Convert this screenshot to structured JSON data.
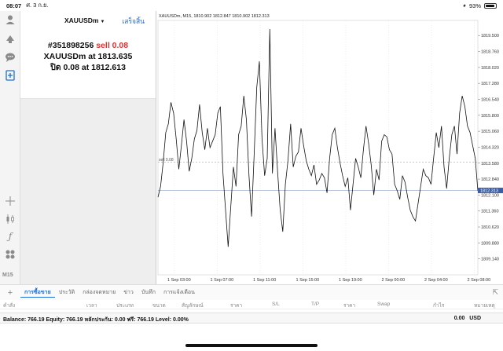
{
  "status_bar": {
    "time": "08:07",
    "date": "ศ. 3 ก.ย.",
    "battery": "93%"
  },
  "order": {
    "symbol": "XAUUSDm",
    "done_label": "เสร็จสิ้น",
    "ticket": "#351898256",
    "side": "sell 0.08",
    "line2_prefix": "XAUUSDm at",
    "open_price": "1813.635",
    "line3_prefix": "ปิด 0.08 at",
    "close_price": "1812.613"
  },
  "toolbar": {
    "timeframe": "M15"
  },
  "chart": {
    "title": "XAUUSDm, M15, 1810.902 1812.847 1810.902 1812.313",
    "current_price": "1812.313",
    "order_line_label": "sell 0.08",
    "colors": {
      "line": "#111111",
      "current_price_bg": "#3a5fa8",
      "order_line": "#909090"
    }
  },
  "chart_data": {
    "type": "line",
    "title": "XAUUSDm, M15, 1810.902 1812.847 1810.902 1812.313",
    "xlabel": "",
    "ylabel": "",
    "ylim": [
      1808.4,
      1820.2
    ],
    "y_ticks": [
      "1819.500",
      "1818.760",
      "1818.020",
      "1817.280",
      "1816.540",
      "1815.800",
      "1815.060",
      "1814.320",
      "1813.580",
      "1812.840",
      "1812.100",
      "1811.360",
      "1810.620",
      "1809.880",
      "1809.140"
    ],
    "x_ticks": [
      "1 Sep 03:00",
      "1 Sep 07:00",
      "1 Sep 11:00",
      "1 Sep 15:00",
      "1 Sep 19:00",
      "2 Sep 00:00",
      "2 Sep 04:00",
      "2 Sep 08:00"
    ],
    "current_price": 1812.313,
    "order_price": 1813.635,
    "series": [
      {
        "values": [
          1812.0,
          1812.5,
          1813.6,
          1815.0,
          1815.4,
          1816.4,
          1815.9,
          1814.7,
          1813.3,
          1814.4,
          1815.6,
          1814.6,
          1813.2,
          1813.8,
          1814.7,
          1815.1,
          1816.3,
          1815.0,
          1814.2,
          1815.2,
          1814.3,
          1814.6,
          1814.9,
          1815.9,
          1816.2,
          1813.1,
          1811.4,
          1809.7,
          1811.6,
          1813.4,
          1812.5,
          1814.9,
          1815.3,
          1816.7,
          1815.6,
          1813.0,
          1811.1,
          1814.0,
          1817.1,
          1818.3,
          1814.7,
          1813.0,
          1813.8,
          1819.8,
          1813.1,
          1815.2,
          1813.2,
          1811.4,
          1810.4,
          1812.6,
          1813.7,
          1815.4,
          1813.4,
          1813.9,
          1814.1,
          1815.2,
          1814.4,
          1813.7,
          1813.3,
          1813.0,
          1813.5,
          1812.6,
          1812.8,
          1813.1,
          1812.9,
          1812.2,
          1813.8,
          1814.9,
          1815.2,
          1814.3,
          1813.6,
          1813.0,
          1812.5,
          1812.9,
          1811.4,
          1812.6,
          1813.8,
          1813.4,
          1812.9,
          1814.2,
          1815.3,
          1814.5,
          1813.5,
          1812.1,
          1813.3,
          1812.8,
          1814.6,
          1814.9,
          1814.8,
          1814.2,
          1814.0,
          1812.6,
          1812.3,
          1811.9,
          1813.0,
          1812.7,
          1812.0,
          1811.4,
          1811.1,
          1810.9,
          1811.7,
          1812.5,
          1813.3,
          1813.0,
          1812.9,
          1812.6,
          1813.8,
          1815.0,
          1814.3,
          1815.3,
          1813.4,
          1812.4,
          1813.8,
          1814.9,
          1815.3,
          1814.0,
          1815.9,
          1816.7,
          1816.2,
          1815.3,
          1815.0,
          1814.4,
          1813.8,
          1812.3
        ]
      }
    ]
  },
  "tabs": [
    {
      "label": "การซื้อขาย",
      "active": true
    },
    {
      "label": "ประวัติ"
    },
    {
      "label": "กล่องจดหมาย"
    },
    {
      "label": "ข่าว"
    },
    {
      "label": "บันทึก"
    },
    {
      "label": "การแจ้งเตือน"
    }
  ],
  "table_headers": {
    "order": "คำสั่ง",
    "time": "เวลา",
    "type": "ประเภท",
    "volume": "ขนาด",
    "symbol": "สัญลักษณ์",
    "price": "ราคา",
    "sl": "S/L",
    "tp": "T/P",
    "price2": "ราคา",
    "swap": "Swap",
    "profit": "กำไร",
    "comment": "หมายเหตุ"
  },
  "balance": {
    "summary": "Balance: 766.19 Equity: 766.19 หลักประกัน: 0.00 ฟรี: 766.19 Level: 0.00%",
    "profit": "0.00",
    "currency": "USD"
  }
}
